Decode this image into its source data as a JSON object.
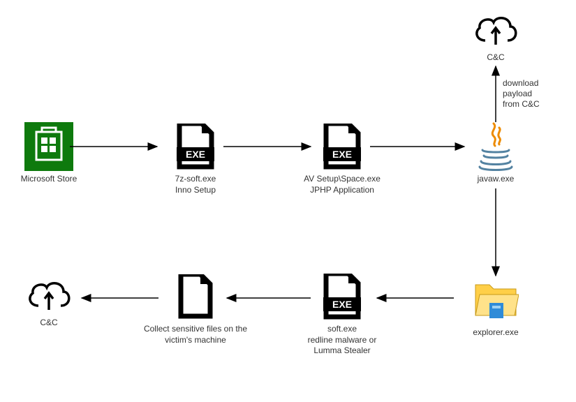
{
  "nodes": {
    "msstore": {
      "label": "Microsoft Store"
    },
    "sevenz": {
      "label1": "7z-soft.exe",
      "label2": "Inno Setup"
    },
    "avsetup": {
      "label1": "AV Setup\\Space.exe",
      "label2": "JPHP Application"
    },
    "javaw": {
      "label": "javaw.exe"
    },
    "cnc_top": {
      "label": "C&C"
    },
    "explorer": {
      "label": "explorer.exe"
    },
    "softexe": {
      "label1": "soft.exe",
      "label2": "redline malware or",
      "label3": "Lumma Stealer"
    },
    "collect": {
      "label1": "Collect sensitive files on the",
      "label2": "victim's machine"
    },
    "cnc_left": {
      "label": "C&C"
    }
  },
  "edges": {
    "download": {
      "line1": "download",
      "line2": "payload",
      "line3": "from C&C"
    }
  }
}
